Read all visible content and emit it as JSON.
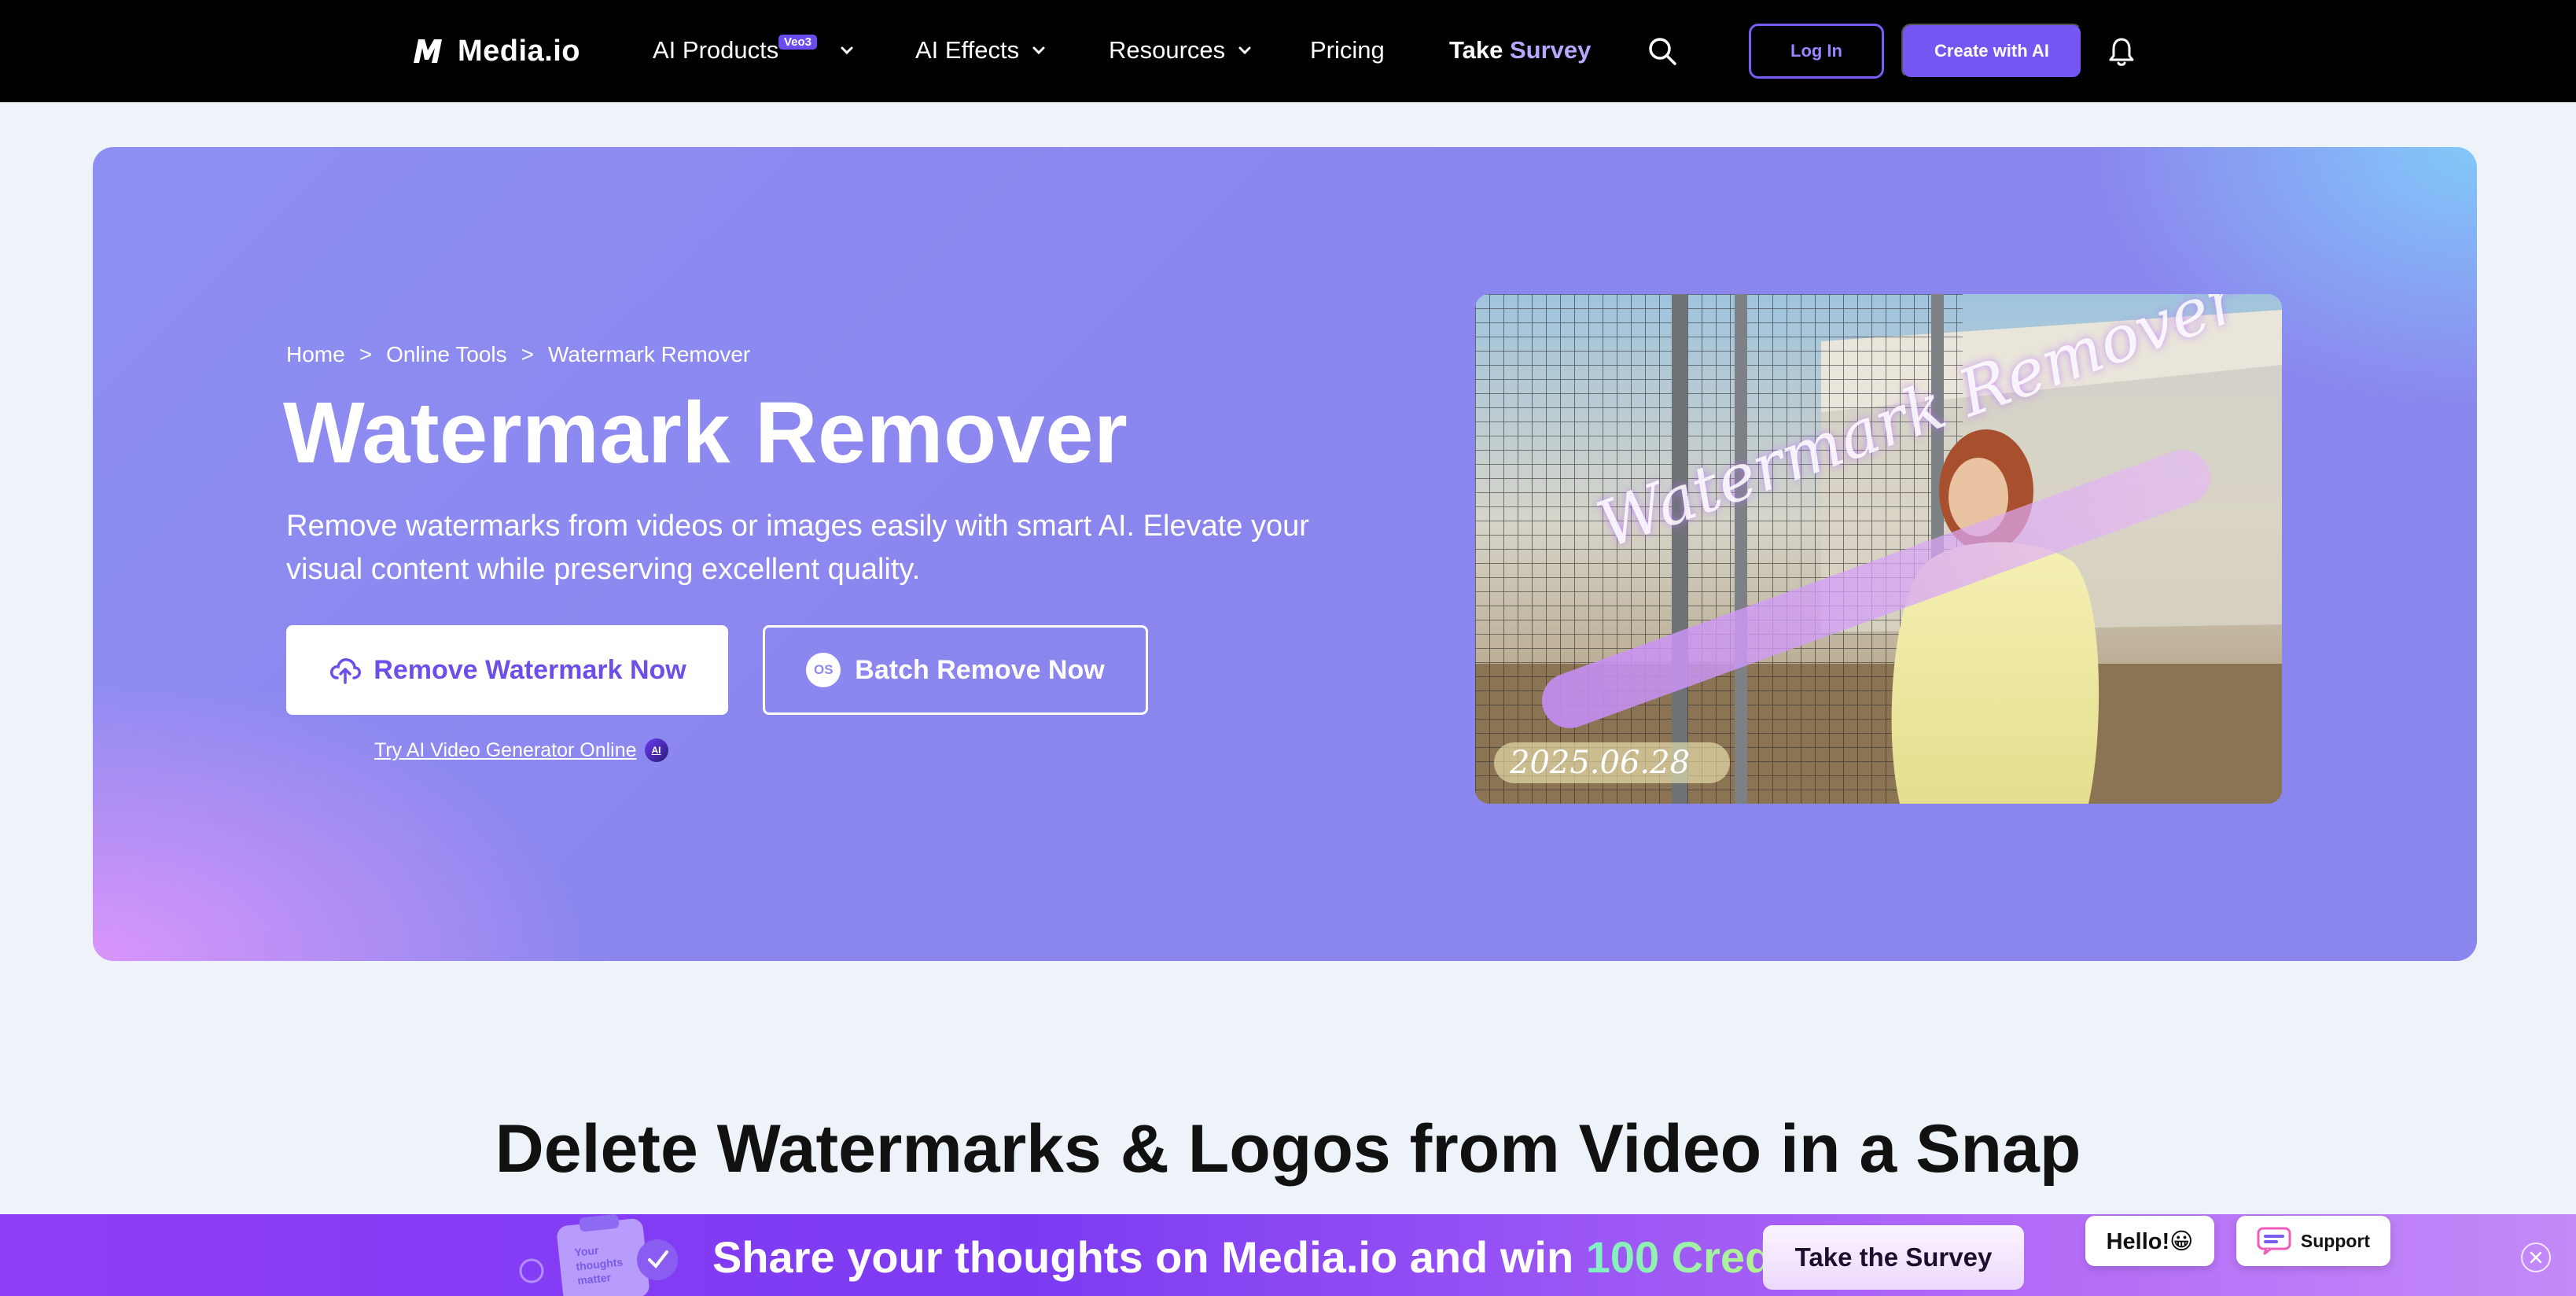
{
  "nav": {
    "brand": "Media.io",
    "items": [
      {
        "label": "AI Products",
        "badge": "Veo3"
      },
      {
        "label": "AI Effects"
      },
      {
        "label": "Resources"
      },
      {
        "label": "Pricing"
      }
    ],
    "survey_part1": "Take",
    "survey_part2": "Survey",
    "login": "Log In",
    "create": "Create with AI",
    "survey_accent_color": "#b8a6ff",
    "accent_color": "#7556f2"
  },
  "hero": {
    "breadcrumb": [
      "Home",
      ">",
      "Online Tools",
      ">",
      "Watermark Remover"
    ],
    "title": "Watermark Remover",
    "description": "Remove watermarks from videos or images easily with smart AI. Elevate your visual content while preserving excellent quality.",
    "primary_button": "Remove Watermark Now",
    "secondary_button": "Batch Remove Now",
    "os_icon_label": "OS",
    "try_link": "Try AI Video Generator Online",
    "try_badge": "AI",
    "image": {
      "watermark_text": "Watermark Remover",
      "date_text": "2025.06.28"
    }
  },
  "section": {
    "title": "Delete Watermarks & Logos from Video in a Snap"
  },
  "banner": {
    "art_caption": [
      "Your",
      "thoughts",
      "matter"
    ],
    "text_before": "Share your thoughts on Media.io and win ",
    "highlight": "100 Credits",
    "button": "Take the Survey",
    "hello": "Hello!😀",
    "support": "Support"
  }
}
